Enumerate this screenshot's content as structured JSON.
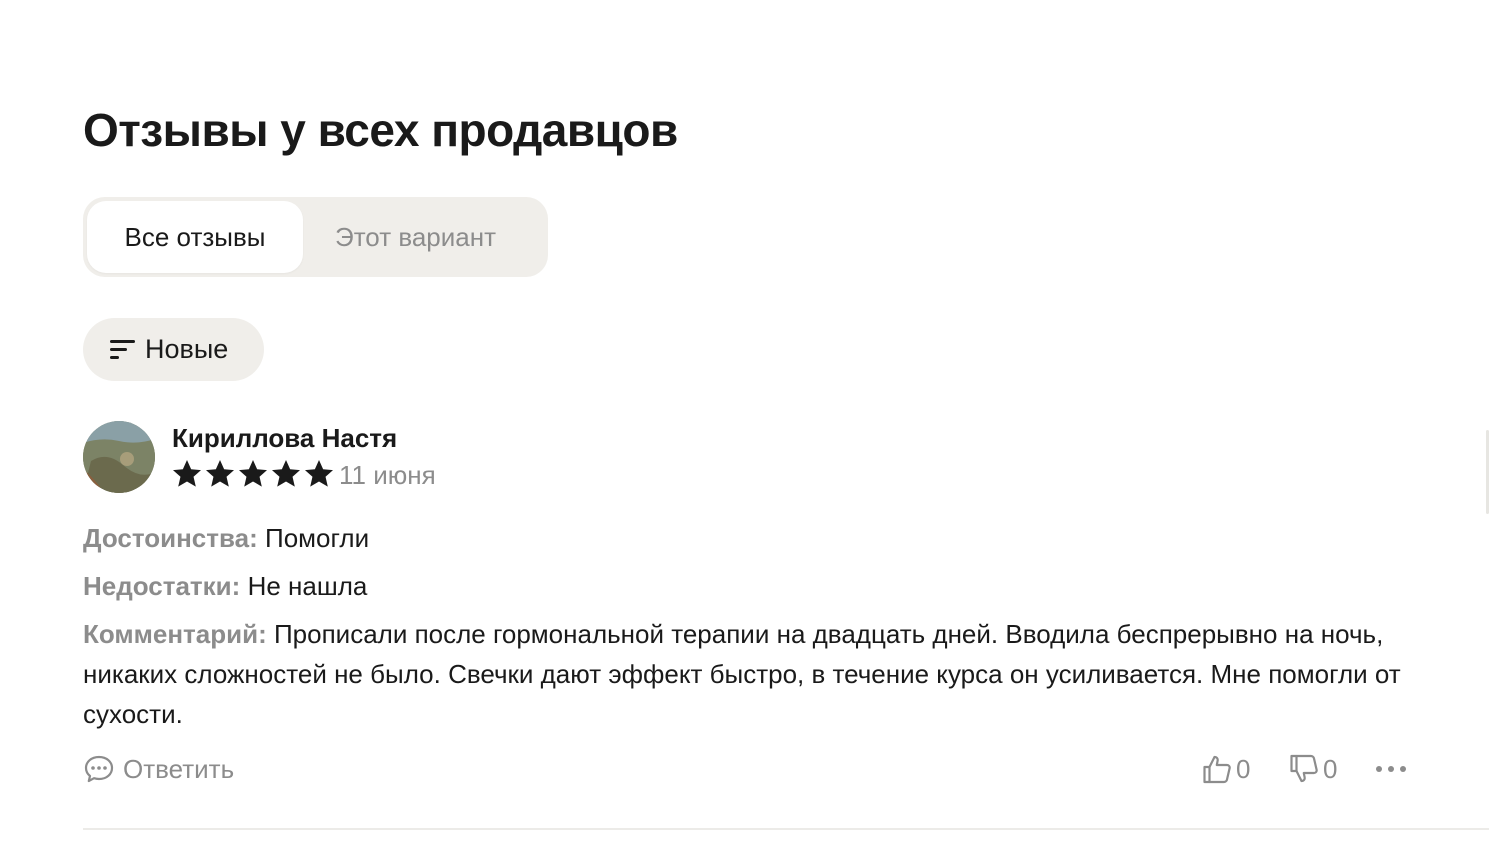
{
  "page": {
    "title": "Отзывы у всех продавцов"
  },
  "tabs": [
    {
      "label": "Все отзывы",
      "active": true
    },
    {
      "label": "Этот вариант",
      "active": false
    }
  ],
  "sort": {
    "label": "Новые",
    "icon": "sort-icon"
  },
  "review": {
    "author": "Кириллова Настя",
    "rating": 5,
    "rating_max": 5,
    "date": "11 июня",
    "pros_label": "Достоинства:",
    "pros": "Помогли",
    "cons_label": "Недостатки:",
    "cons": "Не нашла",
    "comment_label": "Комментарий:",
    "comment": "Прописали после гормональной терапии на двадцать дней. Вводила беспрерывно на ночь, никаких сложностей не было. Свечки дают эффект быстро, в течение курса он усиливается. Мне помогли от сухости.",
    "reply_label": "Ответить",
    "likes": "0",
    "dislikes": "0"
  },
  "colors": {
    "text": "#1a1a1a",
    "muted": "#8c8c8c",
    "chip_bg": "#f0eeea",
    "divider": "#ecebe8"
  }
}
